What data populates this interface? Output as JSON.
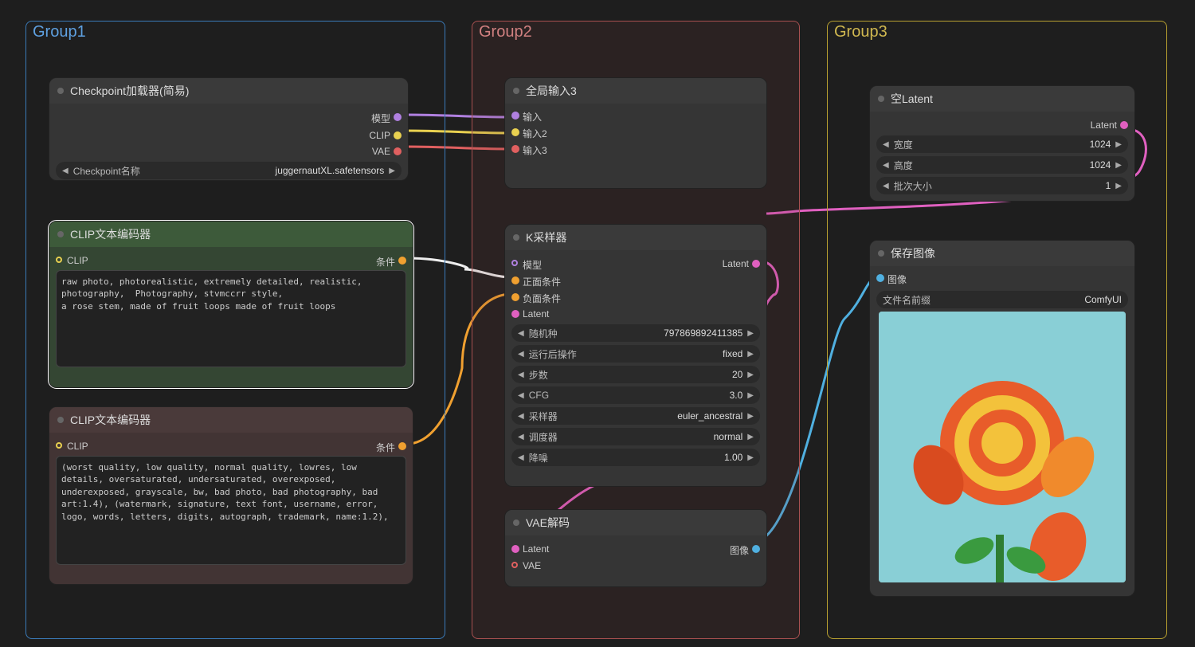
{
  "groups": {
    "g1": "Group1",
    "g2": "Group2",
    "g3": "Group3"
  },
  "loader": {
    "title": "Checkpoint加载器(简易)",
    "out_model": "模型",
    "out_clip": "CLIP",
    "out_vae": "VAE",
    "ckpt_label": "Checkpoint名称",
    "ckpt_value": "juggernautXL.safetensors"
  },
  "clip_pos": {
    "title": "CLIP文本编码器",
    "in_clip": "CLIP",
    "out_cond": "条件",
    "text": "raw photo, photorealistic, extremely detailed, realistic, photography,  Photography, stvmccrr style,\na rose stem, made of fruit loops made of fruit loops"
  },
  "clip_neg": {
    "title": "CLIP文本编码器",
    "in_clip": "CLIP",
    "out_cond": "条件",
    "text": "(worst quality, low quality, normal quality, lowres, low details, oversaturated, undersaturated, overexposed, underexposed, grayscale, bw, bad photo, bad photography, bad art:1.4), (watermark, signature, text font, username, error, logo, words, letters, digits, autograph, trademark, name:1.2),"
  },
  "global_in": {
    "title": "全局输入3",
    "in1": "输入",
    "in2": "输入2",
    "in3": "输入3"
  },
  "sampler": {
    "title": "K采样器",
    "in_model": "模型",
    "in_pos": "正面条件",
    "in_neg": "负面条件",
    "in_latent": "Latent",
    "out_latent": "Latent",
    "seed_l": "随机种",
    "seed_v": "797869892411385",
    "after_l": "运行后操作",
    "after_v": "fixed",
    "steps_l": "步数",
    "steps_v": "20",
    "cfg_l": "CFG",
    "cfg_v": "3.0",
    "sampler_l": "采样器",
    "sampler_v": "euler_ancestral",
    "scheduler_l": "调度器",
    "scheduler_v": "normal",
    "denoise_l": "降噪",
    "denoise_v": "1.00"
  },
  "vae_decode": {
    "title": "VAE解码",
    "in_latent": "Latent",
    "in_vae": "VAE",
    "out_image": "图像"
  },
  "empty_latent": {
    "title": "空Latent",
    "out": "Latent",
    "w_l": "宽度",
    "w_v": "1024",
    "h_l": "高度",
    "h_v": "1024",
    "b_l": "批次大小",
    "b_v": "1"
  },
  "save": {
    "title": "保存图像",
    "in_image": "图像",
    "prefix_l": "文件名前缀",
    "prefix_v": "ComfyUI"
  }
}
